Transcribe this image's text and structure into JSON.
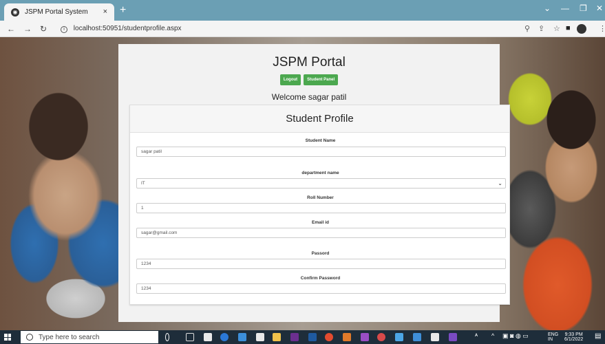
{
  "browser": {
    "tab_title": "JSPM Portal System",
    "tab_close": "×",
    "new_tab": "+",
    "url": "localhost:50951/studentprofile.aspx",
    "window_controls": [
      "⌄",
      "—",
      "❐",
      "✕"
    ]
  },
  "portal": {
    "title": "JSPM Portal",
    "logout_label": "Logout",
    "student_panel_label": "Student Panel",
    "welcome": "Welcome sagar patil"
  },
  "profile": {
    "heading": "Student Profile",
    "fields": [
      {
        "label": "Student Name",
        "value": "sagar patil"
      },
      {
        "label": "department name",
        "value": "IT"
      },
      {
        "label": "Roll Number",
        "value": "1"
      },
      {
        "label": "Email id",
        "value": "sagar@gmail.com"
      },
      {
        "label": "Passord",
        "value": "1234"
      },
      {
        "label": "Confirm Password",
        "value": "1234"
      }
    ]
  },
  "taskbar": {
    "search_placeholder": "Type here to search",
    "lang": "ENG",
    "lang_sub": "IN",
    "time": "9:33 PM",
    "date": "6/1/2022"
  },
  "colors": {
    "button_green": "#4ca84f",
    "tabbar": "#6b9fb4",
    "taskbar": "#1e2d3a"
  }
}
